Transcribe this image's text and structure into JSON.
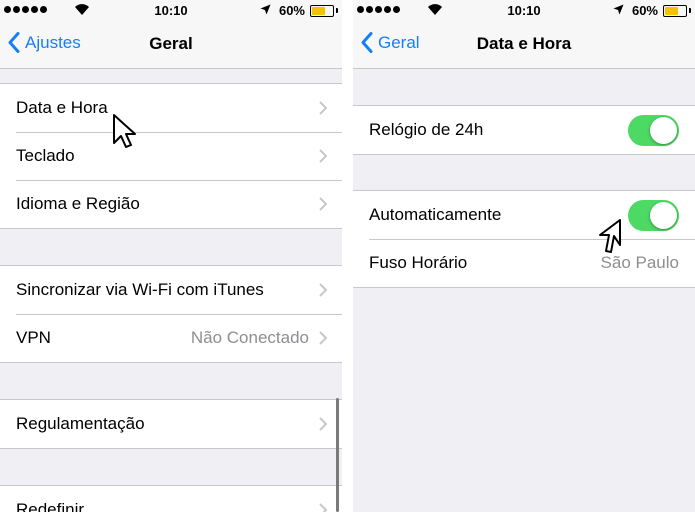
{
  "status_bar": {
    "time": "10:10",
    "battery": "60%",
    "battery_level": 0.6,
    "battery_color": "#f5c200"
  },
  "left_screen": {
    "nav": {
      "back_label": "Ajustes",
      "title": "Geral"
    },
    "groups": [
      {
        "rows": [
          {
            "label": "Data e Hora"
          },
          {
            "label": "Teclado"
          },
          {
            "label": "Idioma e Região"
          }
        ]
      },
      {
        "rows": [
          {
            "label": "Sincronizar via Wi-Fi com iTunes"
          },
          {
            "label": "VPN",
            "value": "Não Conectado"
          }
        ]
      },
      {
        "rows": [
          {
            "label": "Regulamentação"
          }
        ]
      },
      {
        "rows": [
          {
            "label": "Redefinir"
          }
        ]
      }
    ]
  },
  "right_screen": {
    "nav": {
      "back_label": "Geral",
      "title": "Data e Hora"
    },
    "groups": [
      {
        "rows": [
          {
            "label": "Relógio de 24h",
            "toggle": true
          }
        ]
      },
      {
        "rows": [
          {
            "label": "Automaticamente",
            "toggle": true
          },
          {
            "label": "Fuso Horário",
            "value": "São Paulo"
          }
        ]
      }
    ]
  },
  "colors": {
    "accent": "#157efb",
    "toggle_on": "#4cd964",
    "background": "#efeff4"
  },
  "icons": [
    "back-chevron-icon",
    "chevron-right-icon",
    "wifi-icon",
    "location-arrow-icon",
    "battery-icon",
    "signal-dots-icon",
    "mouse-cursor-icon"
  ]
}
